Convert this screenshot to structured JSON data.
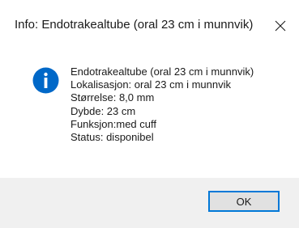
{
  "dialog": {
    "title": "Info: Endotrakealtube (oral 23 cm i munnvik)",
    "close_icon": "close-icon",
    "icon": "info-icon",
    "accent_color": "#0078d7",
    "message_lines": [
      "Endotrakealtube (oral 23 cm i munnvik)",
      "Lokalisasjon: oral 23 cm i munnvik",
      "Størrelse: 8,0 mm",
      "Dybde: 23 cm",
      "Funksjon:med cuff",
      "Status: disponibel"
    ],
    "ok_label": "OK"
  }
}
